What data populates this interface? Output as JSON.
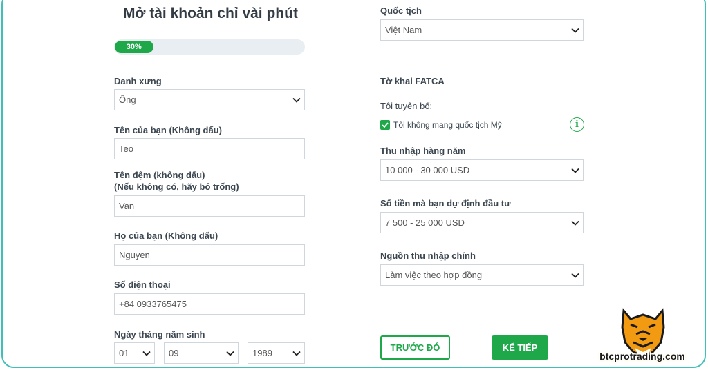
{
  "form": {
    "title": "Mở tài khoản chỉ vài phút",
    "progress": {
      "label": "30%",
      "value": 0.3
    },
    "salutation": {
      "label": "Danh xưng",
      "value": "Ông"
    },
    "first_name": {
      "label": "Tên của bạn (Không dấu)",
      "value": "Teo"
    },
    "middle_name": {
      "label_line1": "Tên đệm (không dấu)",
      "label_line2": "(Nếu không có, hãy bỏ trống)",
      "value": "Van"
    },
    "last_name": {
      "label": "Họ của bạn (Không dấu)",
      "value": "Nguyen"
    },
    "phone": {
      "label": "Số điện thoại",
      "value": "+84 0933765475"
    },
    "birthdate": {
      "label": "Ngày tháng năm sinh",
      "day": "01",
      "month": "09",
      "year": "1989"
    },
    "nationality": {
      "label": "Quốc tịch",
      "value": "Việt Nam"
    },
    "fatca": {
      "title": "Tờ khai FATCA",
      "declare": "Tôi tuyên bố:",
      "checkbox_label": "Tôi không mang quốc tịch Mỹ",
      "checked": true
    },
    "annual_income": {
      "label": "Thu nhập hàng năm",
      "value": "10 000 - 30 000 USD"
    },
    "investment_amount": {
      "label": "Số tiền mà bạn dự định đầu tư",
      "value": "7 500 - 25 000 USD"
    },
    "income_source": {
      "label": "Nguồn thu nhập chính",
      "value": "Làm việc theo hợp đồng"
    },
    "buttons": {
      "prev": "TRƯỚC ĐÓ",
      "next": "KẾ TIẾP"
    }
  },
  "watermark": {
    "text": "btcprotrading.com"
  },
  "colors": {
    "accent": "#1ea84a",
    "frame": "#3fbfb7"
  }
}
